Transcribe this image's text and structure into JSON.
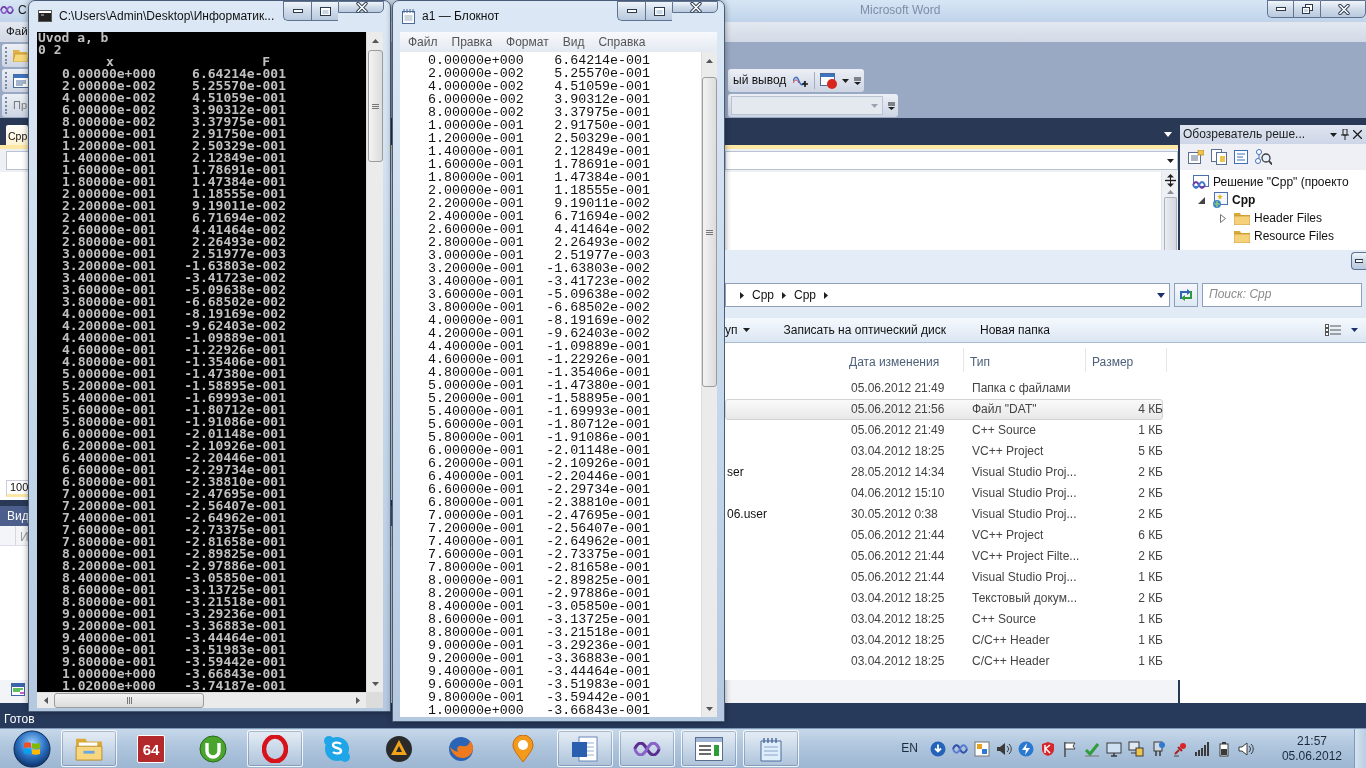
{
  "vs_window": {
    "title": "C",
    "background_title": "Microsoft Word",
    "menu": [
      "Фай"
    ],
    "toolbar_text": "ый вывод",
    "toolbar_combo": "Пр",
    "document_tab": {
      "label": "Cpp",
      "selected": true
    },
    "zoom": "100",
    "bottom_panel": {
      "title": "Вид",
      "column_1": "И"
    },
    "status": "Готов",
    "solution_explorer": {
      "title": "Обозреватель реше...",
      "tree": [
        {
          "label": "Решение \"Cpp\" (проекто",
          "kind": "solution",
          "expandable": false,
          "children": [
            {
              "label": "Cpp",
              "kind": "project",
              "expandable": true,
              "expanded": true,
              "children": [
                {
                  "label": "Header Files",
                  "kind": "folder",
                  "expandable": true,
                  "expanded": false
                },
                {
                  "label": "Resource Files",
                  "kind": "folder",
                  "expandable": false
                }
              ]
            }
          ]
        }
      ]
    }
  },
  "console": {
    "title": "C:\\Users\\Admin\\Desktop\\Информатик...",
    "lines": [
      "Uvod a, b",
      "0 2"
    ],
    "columns": [
      "x",
      "F"
    ],
    "rows": [
      {
        "x": "0.00000e+000",
        "f": "6.64214e-001"
      },
      {
        "x": "2.00000e-002",
        "f": "5.25570e-001"
      },
      {
        "x": "4.00000e-002",
        "f": "4.51059e-001"
      },
      {
        "x": "6.00000e-002",
        "f": "3.90312e-001"
      },
      {
        "x": "8.00000e-002",
        "f": "3.37975e-001"
      },
      {
        "x": "1.00000e-001",
        "f": "2.91750e-001"
      },
      {
        "x": "1.20000e-001",
        "f": "2.50329e-001"
      },
      {
        "x": "1.40000e-001",
        "f": "2.12849e-001"
      },
      {
        "x": "1.60000e-001",
        "f": "1.78691e-001"
      },
      {
        "x": "1.80000e-001",
        "f": "1.47384e-001"
      },
      {
        "x": "2.00000e-001",
        "f": "1.18555e-001"
      },
      {
        "x": "2.20000e-001",
        "f": "9.19011e-002"
      },
      {
        "x": "2.40000e-001",
        "f": "6.71694e-002"
      },
      {
        "x": "2.60000e-001",
        "f": "4.41464e-002"
      },
      {
        "x": "2.80000e-001",
        "f": "2.26493e-002"
      },
      {
        "x": "3.00000e-001",
        "f": "2.51977e-003"
      },
      {
        "x": "3.20000e-001",
        "f": "-1.63803e-002"
      },
      {
        "x": "3.40000e-001",
        "f": "-3.41723e-002"
      },
      {
        "x": "3.60000e-001",
        "f": "-5.09638e-002"
      },
      {
        "x": "3.80000e-001",
        "f": "-6.68502e-002"
      },
      {
        "x": "4.00000e-001",
        "f": "-8.19169e-002"
      },
      {
        "x": "4.20000e-001",
        "f": "-9.62403e-002"
      },
      {
        "x": "4.40000e-001",
        "f": "-1.09889e-001"
      },
      {
        "x": "4.60000e-001",
        "f": "-1.22926e-001"
      },
      {
        "x": "4.80000e-001",
        "f": "-1.35406e-001"
      },
      {
        "x": "5.00000e-001",
        "f": "-1.47380e-001"
      },
      {
        "x": "5.20000e-001",
        "f": "-1.58895e-001"
      },
      {
        "x": "5.40000e-001",
        "f": "-1.69993e-001"
      },
      {
        "x": "5.60000e-001",
        "f": "-1.80712e-001"
      },
      {
        "x": "5.80000e-001",
        "f": "-1.91086e-001"
      },
      {
        "x": "6.00000e-001",
        "f": "-2.01148e-001"
      },
      {
        "x": "6.20000e-001",
        "f": "-2.10926e-001"
      },
      {
        "x": "6.40000e-001",
        "f": "-2.20446e-001"
      },
      {
        "x": "6.60000e-001",
        "f": "-2.29734e-001"
      },
      {
        "x": "6.80000e-001",
        "f": "-2.38810e-001"
      },
      {
        "x": "7.00000e-001",
        "f": "-2.47695e-001"
      },
      {
        "x": "7.20000e-001",
        "f": "-2.56407e-001"
      },
      {
        "x": "7.40000e-001",
        "f": "-2.64962e-001"
      },
      {
        "x": "7.60000e-001",
        "f": "-2.73375e-001"
      },
      {
        "x": "7.80000e-001",
        "f": "-2.81658e-001"
      },
      {
        "x": "8.00000e-001",
        "f": "-2.89825e-001"
      },
      {
        "x": "8.20000e-001",
        "f": "-2.97886e-001"
      },
      {
        "x": "8.40000e-001",
        "f": "-3.05850e-001"
      },
      {
        "x": "8.60000e-001",
        "f": "-3.13725e-001"
      },
      {
        "x": "8.80000e-001",
        "f": "-3.21518e-001"
      },
      {
        "x": "9.00000e-001",
        "f": "-3.29236e-001"
      },
      {
        "x": "9.20000e-001",
        "f": "-3.36883e-001"
      },
      {
        "x": "9.40000e-001",
        "f": "-3.44464e-001"
      },
      {
        "x": "9.60000e-001",
        "f": "-3.51983e-001"
      },
      {
        "x": "9.80000e-001",
        "f": "-3.59442e-001"
      },
      {
        "x": "1.00000e+000",
        "f": "-3.66843e-001"
      },
      {
        "x": "1.02000e+000",
        "f": "-3.74187e-001"
      }
    ]
  },
  "notepad": {
    "title": "a1 — Блокнот",
    "menu": [
      "Файл",
      "Правка",
      "Формат",
      "Вид",
      "Справка"
    ],
    "rows": [
      {
        "x": "0.00000e+000",
        "f": "6.64214e-001"
      },
      {
        "x": "2.00000e-002",
        "f": "5.25570e-001"
      },
      {
        "x": "4.00000e-002",
        "f": "4.51059e-001"
      },
      {
        "x": "6.00000e-002",
        "f": "3.90312e-001"
      },
      {
        "x": "8.00000e-002",
        "f": "3.37975e-001"
      },
      {
        "x": "1.00000e-001",
        "f": "2.91750e-001"
      },
      {
        "x": "1.20000e-001",
        "f": "2.50329e-001"
      },
      {
        "x": "1.40000e-001",
        "f": "2.12849e-001"
      },
      {
        "x": "1.60000e-001",
        "f": "1.78691e-001"
      },
      {
        "x": "1.80000e-001",
        "f": "1.47384e-001"
      },
      {
        "x": "2.00000e-001",
        "f": "1.18555e-001"
      },
      {
        "x": "2.20000e-001",
        "f": "9.19011e-002"
      },
      {
        "x": "2.40000e-001",
        "f": "6.71694e-002"
      },
      {
        "x": "2.60000e-001",
        "f": "4.41464e-002"
      },
      {
        "x": "2.80000e-001",
        "f": "2.26493e-002"
      },
      {
        "x": "3.00000e-001",
        "f": "2.51977e-003"
      },
      {
        "x": "3.20000e-001",
        "f": "-1.63803e-002"
      },
      {
        "x": "3.40000e-001",
        "f": "-3.41723e-002"
      },
      {
        "x": "3.60000e-001",
        "f": "-5.09638e-002"
      },
      {
        "x": "3.80000e-001",
        "f": "-6.68502e-002"
      },
      {
        "x": "4.00000e-001",
        "f": "-8.19169e-002"
      },
      {
        "x": "4.20000e-001",
        "f": "-9.62403e-002"
      },
      {
        "x": "4.40000e-001",
        "f": "-1.09889e-001"
      },
      {
        "x": "4.60000e-001",
        "f": "-1.22926e-001"
      },
      {
        "x": "4.80000e-001",
        "f": "-1.35406e-001"
      },
      {
        "x": "5.00000e-001",
        "f": "-1.47380e-001"
      },
      {
        "x": "5.20000e-001",
        "f": "-1.58895e-001"
      },
      {
        "x": "5.40000e-001",
        "f": "-1.69993e-001"
      },
      {
        "x": "5.60000e-001",
        "f": "-1.80712e-001"
      },
      {
        "x": "5.80000e-001",
        "f": "-1.91086e-001"
      },
      {
        "x": "6.00000e-001",
        "f": "-2.01148e-001"
      },
      {
        "x": "6.20000e-001",
        "f": "-2.10926e-001"
      },
      {
        "x": "6.40000e-001",
        "f": "-2.20446e-001"
      },
      {
        "x": "6.60000e-001",
        "f": "-2.29734e-001"
      },
      {
        "x": "6.80000e-001",
        "f": "-2.38810e-001"
      },
      {
        "x": "7.00000e-001",
        "f": "-2.47695e-001"
      },
      {
        "x": "7.20000e-001",
        "f": "-2.56407e-001"
      },
      {
        "x": "7.40000e-001",
        "f": "-2.64962e-001"
      },
      {
        "x": "7.60000e-001",
        "f": "-2.73375e-001"
      },
      {
        "x": "7.80000e-001",
        "f": "-2.81658e-001"
      },
      {
        "x": "8.00000e-001",
        "f": "-2.89825e-001"
      },
      {
        "x": "8.20000e-001",
        "f": "-2.97886e-001"
      },
      {
        "x": "8.40000e-001",
        "f": "-3.05850e-001"
      },
      {
        "x": "8.60000e-001",
        "f": "-3.13725e-001"
      },
      {
        "x": "8.80000e-001",
        "f": "-3.21518e-001"
      },
      {
        "x": "9.00000e-001",
        "f": "-3.29236e-001"
      },
      {
        "x": "9.20000e-001",
        "f": "-3.36883e-001"
      },
      {
        "x": "9.40000e-001",
        "f": "-3.44464e-001"
      },
      {
        "x": "9.60000e-001",
        "f": "-3.51983e-001"
      },
      {
        "x": "9.80000e-001",
        "f": "-3.59442e-001"
      },
      {
        "x": "1.00000e+000",
        "f": "-3.66843e-001"
      }
    ]
  },
  "explorer": {
    "breadcrumb": [
      "Cpp",
      "Cpp"
    ],
    "search_placeholder": "Поиск: Cpp",
    "toolbar": [
      {
        "label": "уп",
        "kind": "menu"
      },
      {
        "label": "Записать на оптический диск",
        "kind": "button"
      },
      {
        "label": "Новая папка",
        "kind": "button"
      }
    ],
    "columns": [
      "Дата изменения",
      "Тип",
      "Размер"
    ],
    "files": [
      {
        "date": "05.06.2012 21:49",
        "type": "Папка с файлами",
        "selected": false
      },
      {
        "date": "05.06.2012 21:56",
        "type": "Файл \"DAT\"",
        "size": "4 КБ",
        "selected": true
      },
      {
        "date": "05.06.2012 21:49",
        "type": "C++ Source",
        "size": "1 КБ",
        "selected": false
      },
      {
        "date": "03.04.2012 18:25",
        "type": "VC++ Project",
        "size": "5 КБ",
        "selected": false
      },
      {
        "name": "ser",
        "date": "28.05.2012 14:34",
        "type": "Visual Studio Proj...",
        "size": "2 КБ",
        "selected": false
      },
      {
        "date": "04.06.2012 15:10",
        "type": "Visual Studio Proj...",
        "size": "2 КБ",
        "selected": false
      },
      {
        "name": "06.user",
        "date": "30.05.2012 0:38",
        "type": "Visual Studio Proj...",
        "size": "2 КБ",
        "selected": false
      },
      {
        "date": "05.06.2012 21:44",
        "type": "VC++ Project",
        "size": "6 КБ",
        "selected": false
      },
      {
        "date": "05.06.2012 21:44",
        "type": "VC++ Project Filte...",
        "size": "2 КБ",
        "selected": false
      },
      {
        "date": "05.06.2012 21:44",
        "type": "Visual Studio Proj...",
        "size": "1 КБ",
        "selected": false
      },
      {
        "date": "03.04.2012 18:25",
        "type": "Текстовый докум...",
        "size": "2 КБ",
        "selected": false
      },
      {
        "date": "03.04.2012 18:25",
        "type": "C++ Source",
        "size": "1 КБ",
        "selected": false
      },
      {
        "date": "03.04.2012 18:25",
        "type": "C/C++ Header",
        "size": "1 КБ",
        "selected": false
      },
      {
        "date": "03.04.2012 18:25",
        "type": "C/C++ Header",
        "size": "1 КБ",
        "selected": false
      }
    ]
  },
  "taskbar": {
    "buttons": [
      {
        "active": true
      },
      {
        "label": "64",
        "active": false
      },
      {
        "active": false
      },
      {
        "active": true
      },
      {
        "active": false
      },
      {
        "active": false
      },
      {
        "active": false
      },
      {
        "active": false
      },
      {
        "active": true
      },
      {
        "active": true
      },
      {
        "active": true
      },
      {
        "active": true
      }
    ],
    "language": "EN",
    "time": "21:57",
    "date": "05.06.2012"
  }
}
